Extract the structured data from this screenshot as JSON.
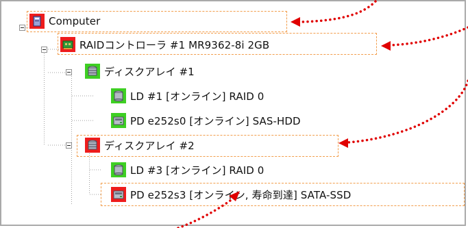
{
  "tree": {
    "root": {
      "label": "Computer",
      "icon": "computer-icon",
      "expanded": true
    },
    "controller": {
      "label": "RAIDコントローラ #1 MR9362-8i 2GB",
      "icon": "raid-controller-icon",
      "expanded": true
    },
    "arrays": [
      {
        "label": "ディスクアレイ #1",
        "icon": "disk-array-icon",
        "status": "normal",
        "expanded": true,
        "children": [
          {
            "label": "LD #1 [オンライン] RAID 0",
            "icon": "logical-drive-icon"
          },
          {
            "label": "PD e252s0 [オンライン] SAS-HDD",
            "icon": "physical-drive-icon",
            "status": "normal"
          }
        ]
      },
      {
        "label": "ディスクアレイ #2",
        "icon": "disk-array-icon",
        "status": "warning",
        "expanded": true,
        "children": [
          {
            "label": "LD #3 [オンライン] RAID 0",
            "icon": "logical-drive-icon"
          },
          {
            "label": "PD e252s3 [オンライン, 寿命到達] SATA-SSD",
            "icon": "physical-drive-icon",
            "status": "warning"
          }
        ]
      }
    ]
  },
  "colors": {
    "warning": "#ee1c1c",
    "normal": "#3ecf23",
    "annotation": "#e00000",
    "highlight_border": "#f29d4b"
  }
}
